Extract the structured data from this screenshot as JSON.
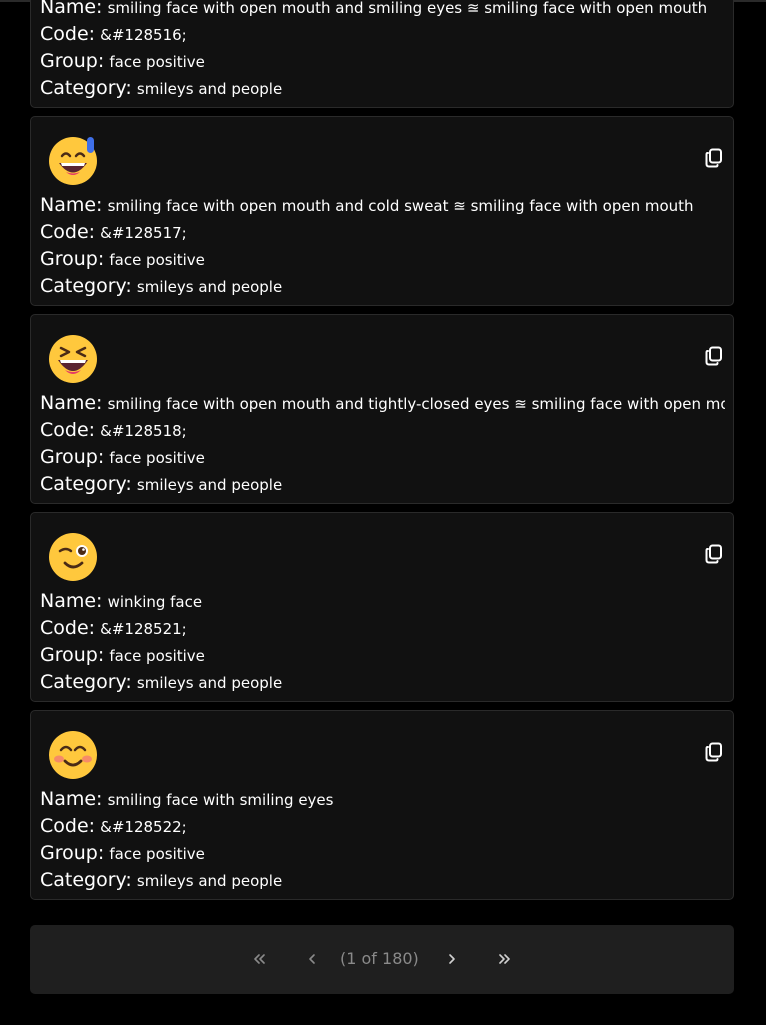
{
  "labels": {
    "name": "Name:",
    "code": "Code:",
    "group": "Group:",
    "category": "Category:"
  },
  "emojis": [
    {
      "icon": "grinning-squinting-face-icon",
      "name": "smiling face with open mouth and smiling eyes ≊ smiling face with open mouth",
      "code": "&#128516;",
      "group": "face positive",
      "category": "smileys and people"
    },
    {
      "icon": "grinning-face-with-sweat-icon",
      "name": "smiling face with open mouth and cold sweat ≊ smiling face with open mouth",
      "code": "&#128517;",
      "group": "face positive",
      "category": "smileys and people"
    },
    {
      "icon": "laughing-face-icon",
      "name": "smiling face with open mouth and tightly-closed eyes ≊ smiling face with open mouth",
      "code": "&#128518;",
      "group": "face positive",
      "category": "smileys and people"
    },
    {
      "icon": "winking-face-icon",
      "name": "winking face",
      "code": "&#128521;",
      "group": "face positive",
      "category": "smileys and people"
    },
    {
      "icon": "smiling-face-with-smiling-eyes-icon",
      "name": "smiling face with smiling eyes",
      "code": "&#128522;",
      "group": "face positive",
      "category": "smileys and people"
    }
  ],
  "pagination": {
    "first": "«",
    "prev": "‹",
    "info": "(1 of 180)",
    "next": "›",
    "last": "»"
  },
  "colors": {
    "page_bg": "#000000",
    "card_bg": "#111111",
    "card_border": "#2a2a2a",
    "pager_bg": "#1f1f1f",
    "emoji_yellow": "#ffc83d",
    "sweat_blue": "#3f6fe8"
  }
}
